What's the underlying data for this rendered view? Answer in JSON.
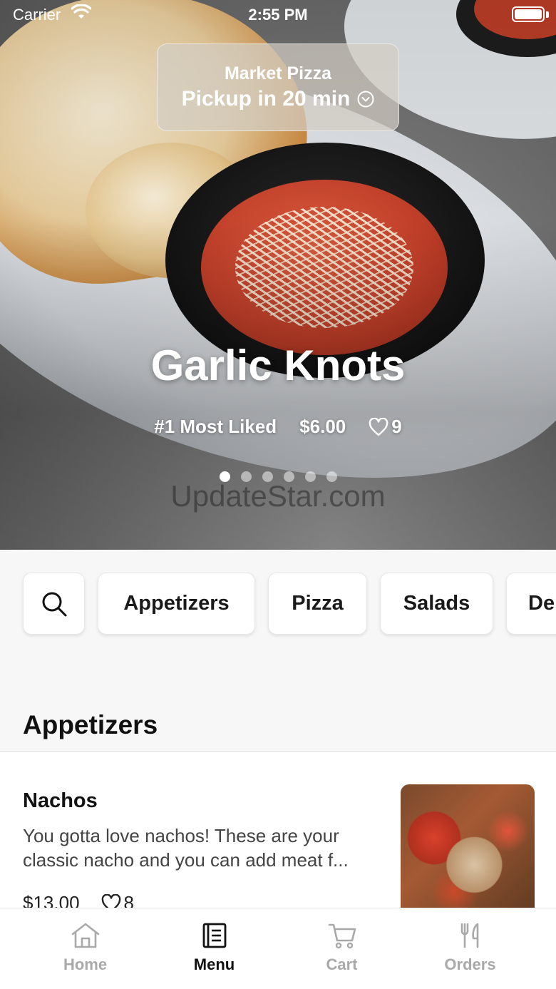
{
  "status_bar": {
    "carrier": "Carrier",
    "time": "2:55 PM"
  },
  "location": {
    "store_name": "Market Pizza",
    "pickup_text": "Pickup in 20 min"
  },
  "featured": {
    "title": "Garlic Knots",
    "rank": "#1 Most Liked",
    "price": "$6.00",
    "likes": "9",
    "slide_count": 6,
    "active_slide": 1
  },
  "watermark": "UpdateStar.com",
  "categories": [
    "Appetizers",
    "Pizza",
    "Salads",
    "De"
  ],
  "section": {
    "title": "Appetizers"
  },
  "items": [
    {
      "name": "Nachos",
      "description": "You gotta love nachos! These are your classic nacho and you can add meat f...",
      "price": "$13.00",
      "likes": "8"
    }
  ],
  "tabs": [
    {
      "label": "Home",
      "icon": "home-icon",
      "active": false
    },
    {
      "label": "Menu",
      "icon": "menu-icon",
      "active": true
    },
    {
      "label": "Cart",
      "icon": "cart-icon",
      "active": false
    },
    {
      "label": "Orders",
      "icon": "utensils-icon",
      "active": false
    }
  ],
  "colors": {
    "active_tab": "#111111",
    "inactive_tab": "#a9a9a9",
    "background": "#f7f7f7"
  }
}
